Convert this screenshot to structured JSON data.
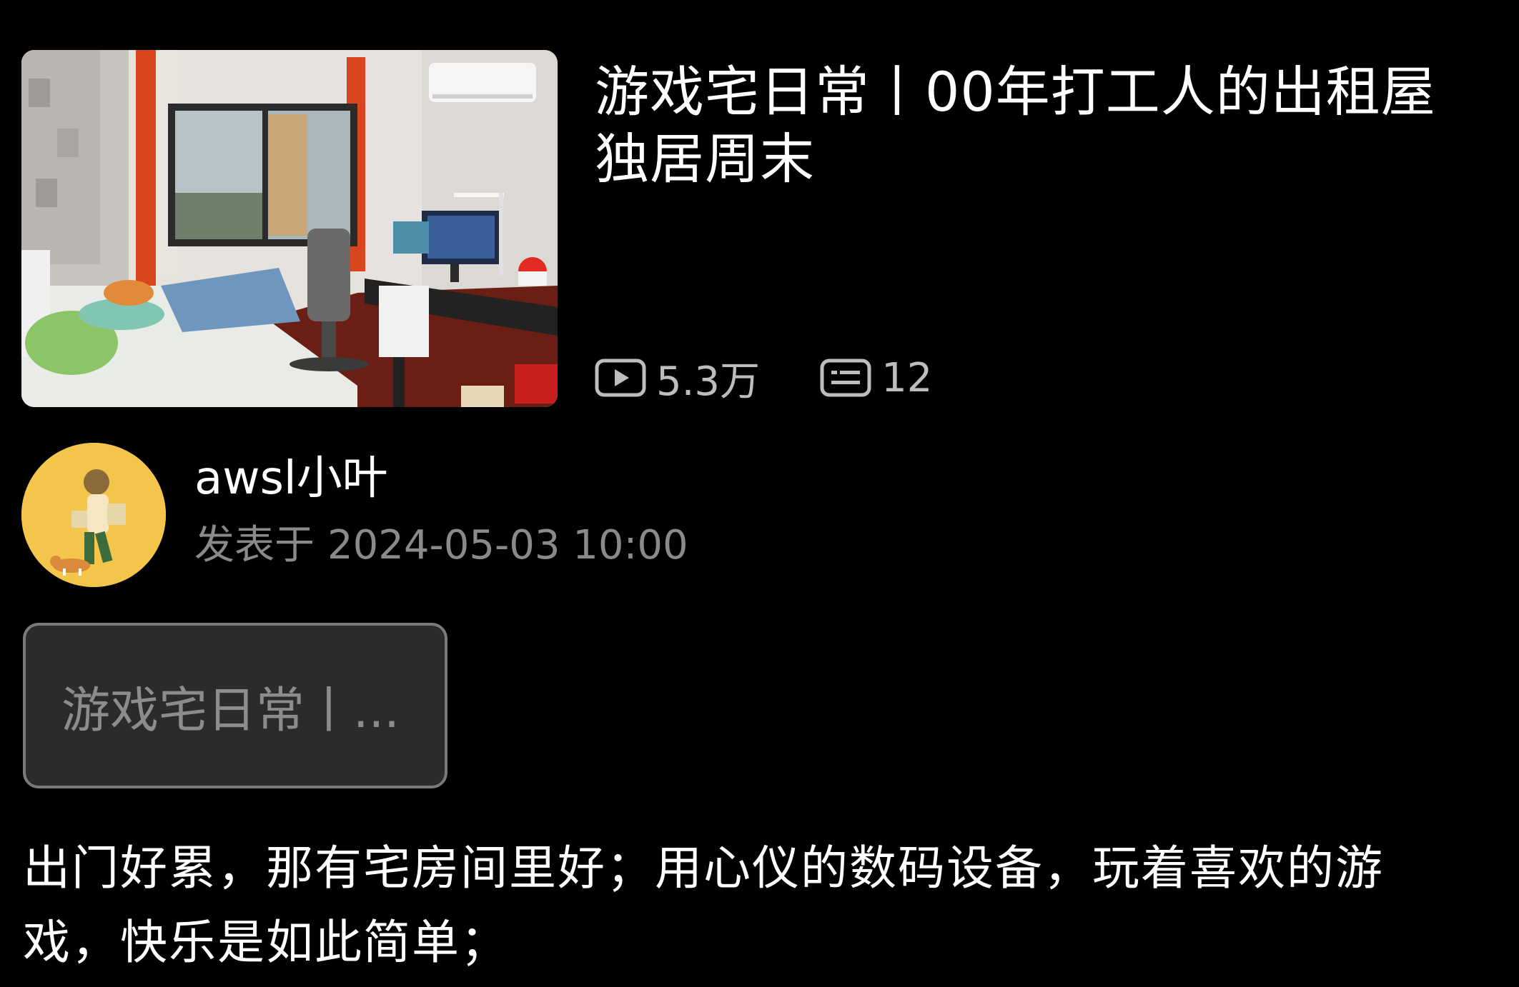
{
  "video": {
    "title": "游戏宅日常丨00年打工人的出租屋独居周末",
    "views_icon": "play-icon",
    "views": "5.3万",
    "comments_icon": "danmaku-icon",
    "comments": "12"
  },
  "author": {
    "avatar_icon": "avatar-illustration",
    "name": "awsl小叶",
    "published_label": "发表于",
    "published_time": "2024-05-03 10:00"
  },
  "chip": {
    "label": "游戏宅日常丨..."
  },
  "description": {
    "text": "出门好累，那有宅房间里好；用心仪的数码设备，玩着喜欢的游戏，快乐是如此简单；"
  },
  "colors": {
    "background": "#000000",
    "title": "#ffffff",
    "meta": "#8a8a8a",
    "stats": "#bdbdbd",
    "chip_bg": "#2b2b2b",
    "chip_border": "#7a7a7a",
    "avatar_bg": "#f3c54a"
  }
}
